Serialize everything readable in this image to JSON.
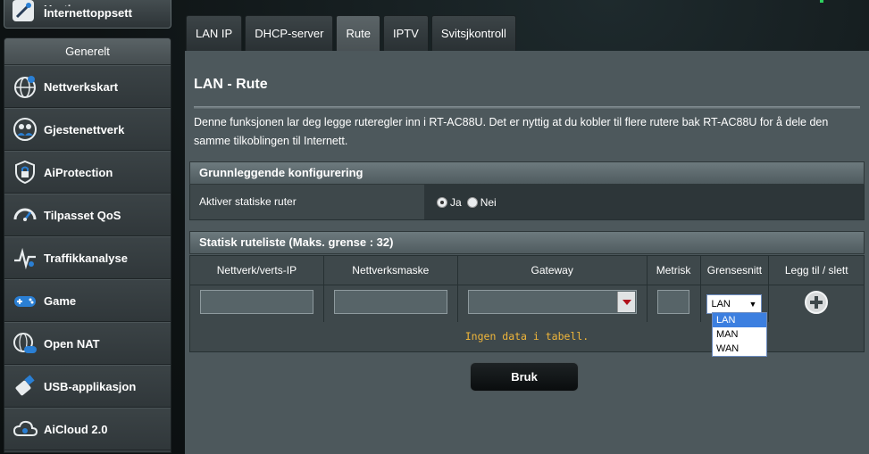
{
  "quick_setup": {
    "label": "Internettoppsett",
    "label_top": "Hurtig"
  },
  "sidebar": {
    "heading": "Generelt",
    "items": [
      {
        "label": "Nettverkskart",
        "icon": "network-map-icon"
      },
      {
        "label": "Gjestenettverk",
        "icon": "guest-network-icon"
      },
      {
        "label": "AiProtection",
        "icon": "lock-shield-icon"
      },
      {
        "label": "Tilpasset QoS",
        "icon": "speedometer-icon"
      },
      {
        "label": "Traffikkanalyse",
        "icon": "traffic-analyzer-icon"
      },
      {
        "label": "Game",
        "icon": "gamepad-icon"
      },
      {
        "label": "Open NAT",
        "icon": "open-nat-icon"
      },
      {
        "label": "USB-applikasjon",
        "icon": "usb-icon"
      },
      {
        "label": "AiCloud 2.0",
        "icon": "cloud-icon"
      }
    ]
  },
  "tabs": [
    "LAN IP",
    "DHCP-server",
    "Rute",
    "IPTV",
    "Svitsjkontroll"
  ],
  "active_tab": "Rute",
  "page": {
    "title": "LAN - Rute",
    "description": "Denne funksjonen lar deg legge ruteregler inn i RT-AC88U. Det er nyttig at du kobler til flere rutere bak RT-AC88U for å dele den samme tilkoblingen til Internett."
  },
  "basic_config": {
    "heading": "Grunnleggende konfigurering",
    "static_routes_label": "Aktiver statiske ruter",
    "yes_label": "Ja",
    "no_label": "Nei",
    "selected": "Ja"
  },
  "route_list": {
    "heading": "Statisk ruteliste (Maks. grense : 32)",
    "columns": [
      "Nettverk/verts-IP",
      "Nettverksmaske",
      "Gateway",
      "Metrisk",
      "Grensesnitt",
      "Legg til / slett"
    ],
    "interface_selected": "LAN",
    "interface_options": [
      "LAN",
      "MAN",
      "WAN"
    ],
    "empty_text": "Ingen data i tabell."
  },
  "apply_button": "Bruk",
  "colors": {
    "panel": "#4d585c",
    "row": "#3e484b",
    "empty_text": "#f0b63a",
    "highlight": "#3c7fe0"
  }
}
